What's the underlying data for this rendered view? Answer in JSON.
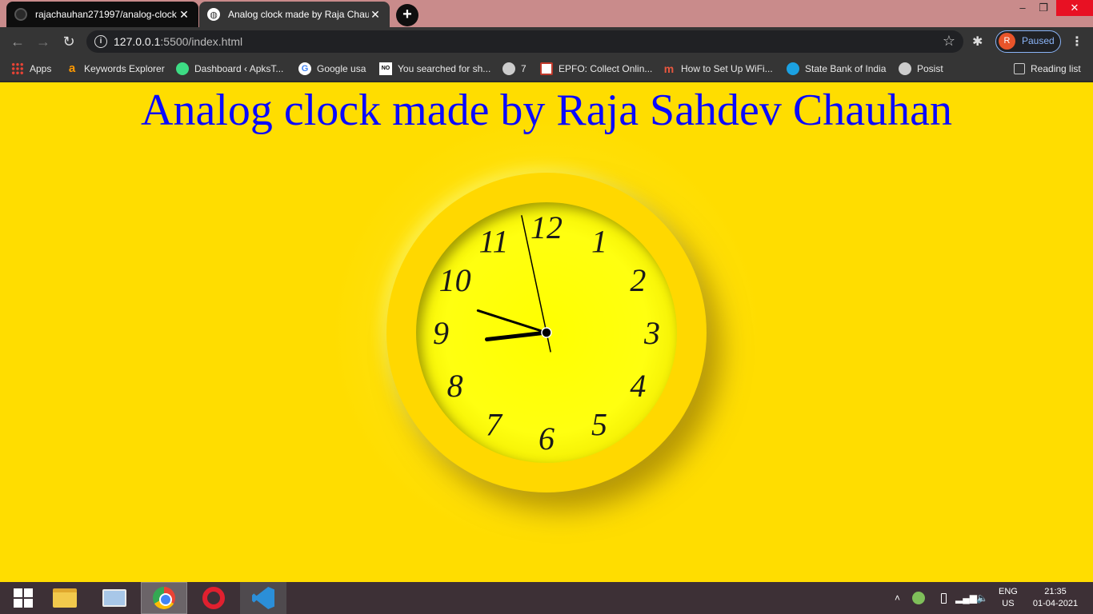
{
  "browser": {
    "tabs": [
      {
        "title": "rajachauhan271997/analog-clock",
        "close": "✕"
      },
      {
        "title": "Analog clock made by Raja Chauhan",
        "close": "✕"
      }
    ],
    "new_tab": "+",
    "window_controls": {
      "minimize": "–",
      "maximize": "❐",
      "close": "✕"
    },
    "nav": {
      "back": "←",
      "forward": "→",
      "reload": "↻"
    },
    "address": {
      "host": "127.0.0.1",
      "rest": ":5500/index.html",
      "info_icon": "i",
      "star": "☆"
    },
    "extensions_icon": "puzzle-icon",
    "profile": {
      "initial": "R",
      "status": "Paused"
    },
    "menu": "⋮"
  },
  "bookmarks": [
    {
      "label": "Apps",
      "icon": "apps-icon"
    },
    {
      "label": "Keywords Explorer",
      "icon": "a"
    },
    {
      "label": "Dashboard ‹ ApksT...",
      "icon": "dashboard-icon"
    },
    {
      "label": "Google usa",
      "icon": "G"
    },
    {
      "label": "You searched for sh...",
      "icon": "NO"
    },
    {
      "label": "7",
      "icon": "globe-icon"
    },
    {
      "label": "EPFO: Collect Onlin...",
      "icon": "epfo-icon"
    },
    {
      "label": "How to Set Up WiFi...",
      "icon": "m"
    },
    {
      "label": "State Bank of India",
      "icon": "sbi-icon"
    },
    {
      "label": "Posist",
      "icon": "globe-icon"
    }
  ],
  "reading_list": "Reading list",
  "page": {
    "heading": "Analog clock made by Raja Sahdev Chauhan",
    "clock": {
      "numerals": [
        "12",
        "1",
        "2",
        "3",
        "4",
        "5",
        "6",
        "7",
        "8",
        "9",
        "10",
        "11"
      ],
      "time": {
        "hours": 8,
        "minutes": 47,
        "seconds": 58
      }
    }
  },
  "taskbar": {
    "apps": [
      "start-icon",
      "file-explorer-icon",
      "this-pc-icon",
      "chrome-icon",
      "opera-icon",
      "vscode-icon"
    ],
    "tray": {
      "chevron": "˄",
      "lang_top": "ENG",
      "lang_bottom": "US",
      "time": "21:35",
      "date": "01-04-2021"
    }
  },
  "colors": {
    "page_bg": "#ffdd00",
    "heading": "#0a0aff",
    "clock_ring": "#ffd800",
    "clock_face": "#ffff00"
  }
}
